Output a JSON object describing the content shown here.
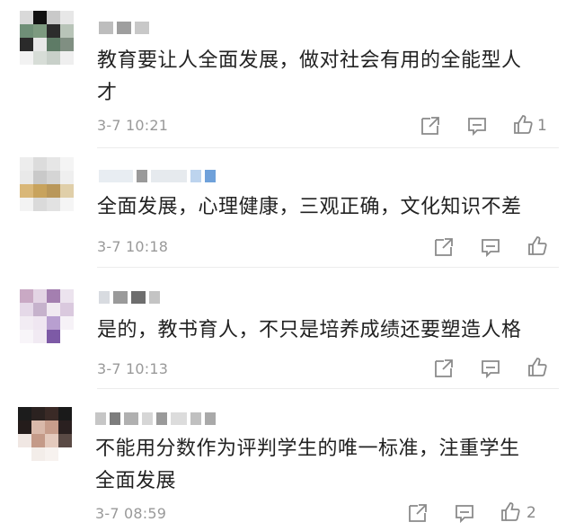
{
  "comments": [
    {
      "text": "教育要让人全面发展，做对社会有用的全能型人\n才",
      "time": "3-7 10:21",
      "likes": "1"
    },
    {
      "text": "全面发展，心理健康，三观正确，文化知识不差",
      "time": "3-7 10:18",
      "likes": ""
    },
    {
      "text": "是的，教书育人，不只是培养成绩还要塑造人格",
      "time": "3-7 10:13",
      "likes": ""
    },
    {
      "text": "不能用分数作为评判学生的唯一标准，注重学生\n全面发展",
      "time": "3-7 08:59",
      "likes": "2"
    }
  ],
  "icons": {
    "share": "share-icon",
    "comment": "comment-icon",
    "like": "thumbs-up-icon"
  },
  "colors": {
    "text": "#222222",
    "meta": "#999999",
    "icon": "#8a8a8a",
    "divider": "#ececec",
    "background": "#ffffff"
  }
}
